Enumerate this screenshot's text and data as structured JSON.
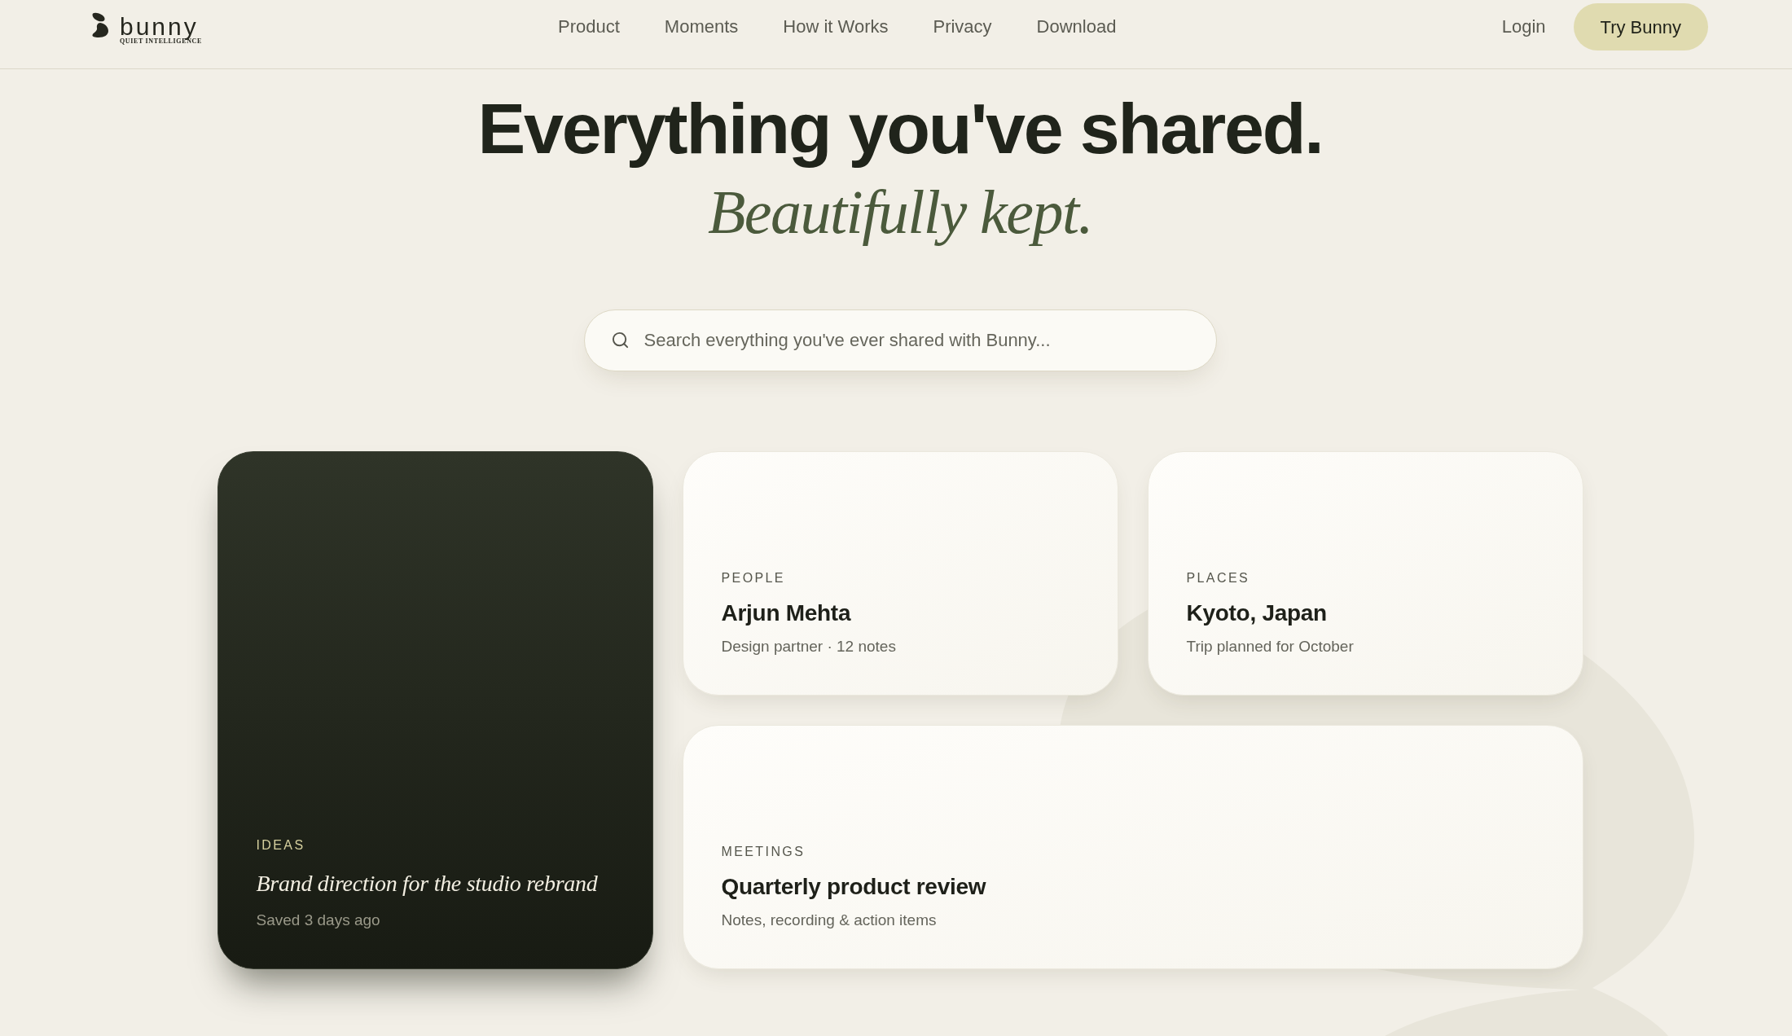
{
  "nav": {
    "logo": {
      "wordmark": "bunny",
      "tagline": "QUIET INTELLIGENCE"
    },
    "links": [
      "Product",
      "Moments",
      "How it Works",
      "Privacy",
      "Download"
    ],
    "login": "Login",
    "cta": "Try Bunny"
  },
  "hero": {
    "title": "Everything you've shared.",
    "subtitle": "Beautifully kept."
  },
  "search": {
    "placeholder": "Search everything you've ever shared with Bunny..."
  },
  "cards": [
    {
      "kind": "light",
      "category": "PEOPLE",
      "title": "Arjun Mehta",
      "meta": "Design partner · 12 notes"
    },
    {
      "kind": "light",
      "category": "PLACES",
      "title": "Kyoto, Japan",
      "meta": "Trip planned for October"
    },
    {
      "kind": "dark",
      "category": "IDEAS",
      "title": "Brand direction for the studio rebrand",
      "meta": "Saved 3 days ago"
    },
    {
      "kind": "wide",
      "category": "MEETINGS",
      "title": "Quarterly product review",
      "meta": "Notes, recording & action items"
    }
  ]
}
